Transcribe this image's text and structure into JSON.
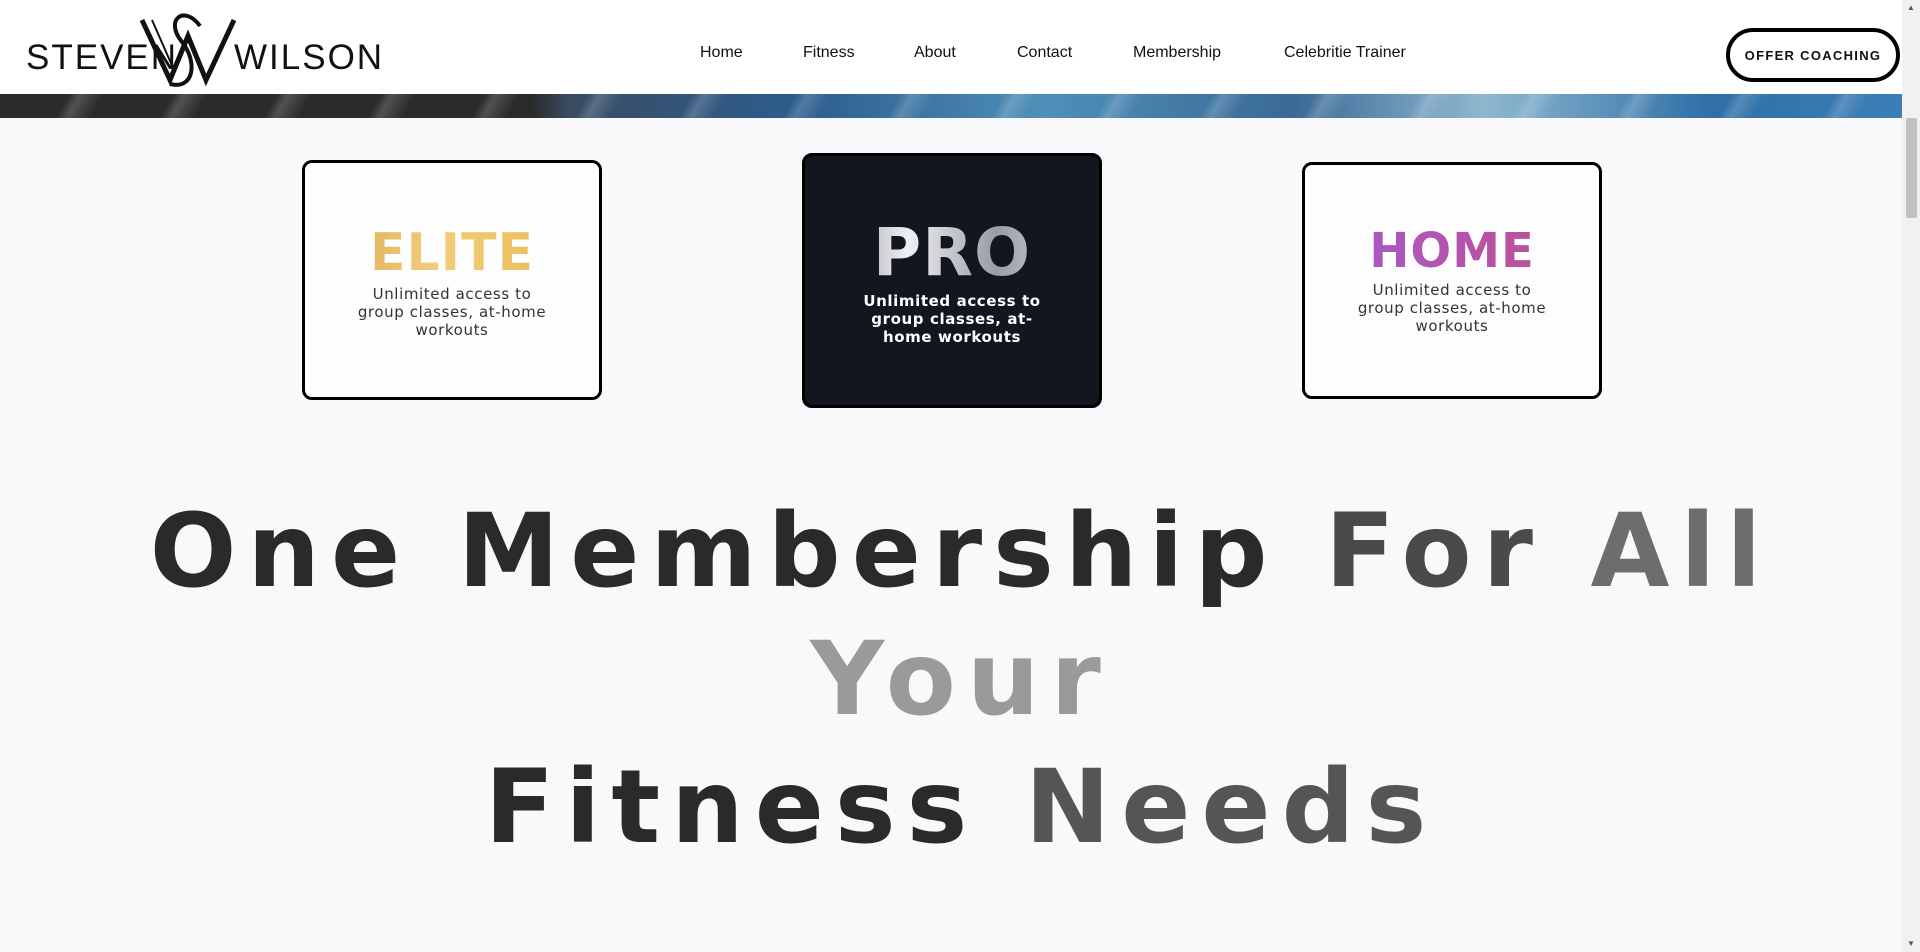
{
  "header": {
    "logo": {
      "left": "STEVEN",
      "right": "WILSON",
      "monogram": "SW"
    },
    "nav": [
      {
        "label": "Home"
      },
      {
        "label": "Fitness"
      },
      {
        "label": "About"
      },
      {
        "label": "Contact"
      },
      {
        "label": "Membership"
      },
      {
        "label": "Celebritie Trainer"
      }
    ],
    "cta_label": "OFFER COACHING"
  },
  "plans": [
    {
      "name": "ELITE",
      "description": "Unlimited access to group classes, at-home workouts"
    },
    {
      "name": "PRO",
      "description": "Unlimited access to group classes, at-home workouts"
    },
    {
      "name": "HOME",
      "description": "Unlimited access to group classes, at-home workouts"
    }
  ],
  "headline": {
    "words": [
      "One",
      "Membership",
      "For",
      "All",
      "Your",
      "Fitness",
      "Needs"
    ]
  },
  "colors": {
    "elite_gradient": [
      "#d7a550",
      "#f2cd7a"
    ],
    "pro_background": "#13161f",
    "home_gradient": [
      "#a25ad2",
      "#c44f8a"
    ],
    "headline_dark": "#2a2a2a",
    "headline_light": "#999999"
  },
  "icons": {
    "scroll_up": "triangle-up-icon",
    "scroll_down": "triangle-down-icon"
  }
}
